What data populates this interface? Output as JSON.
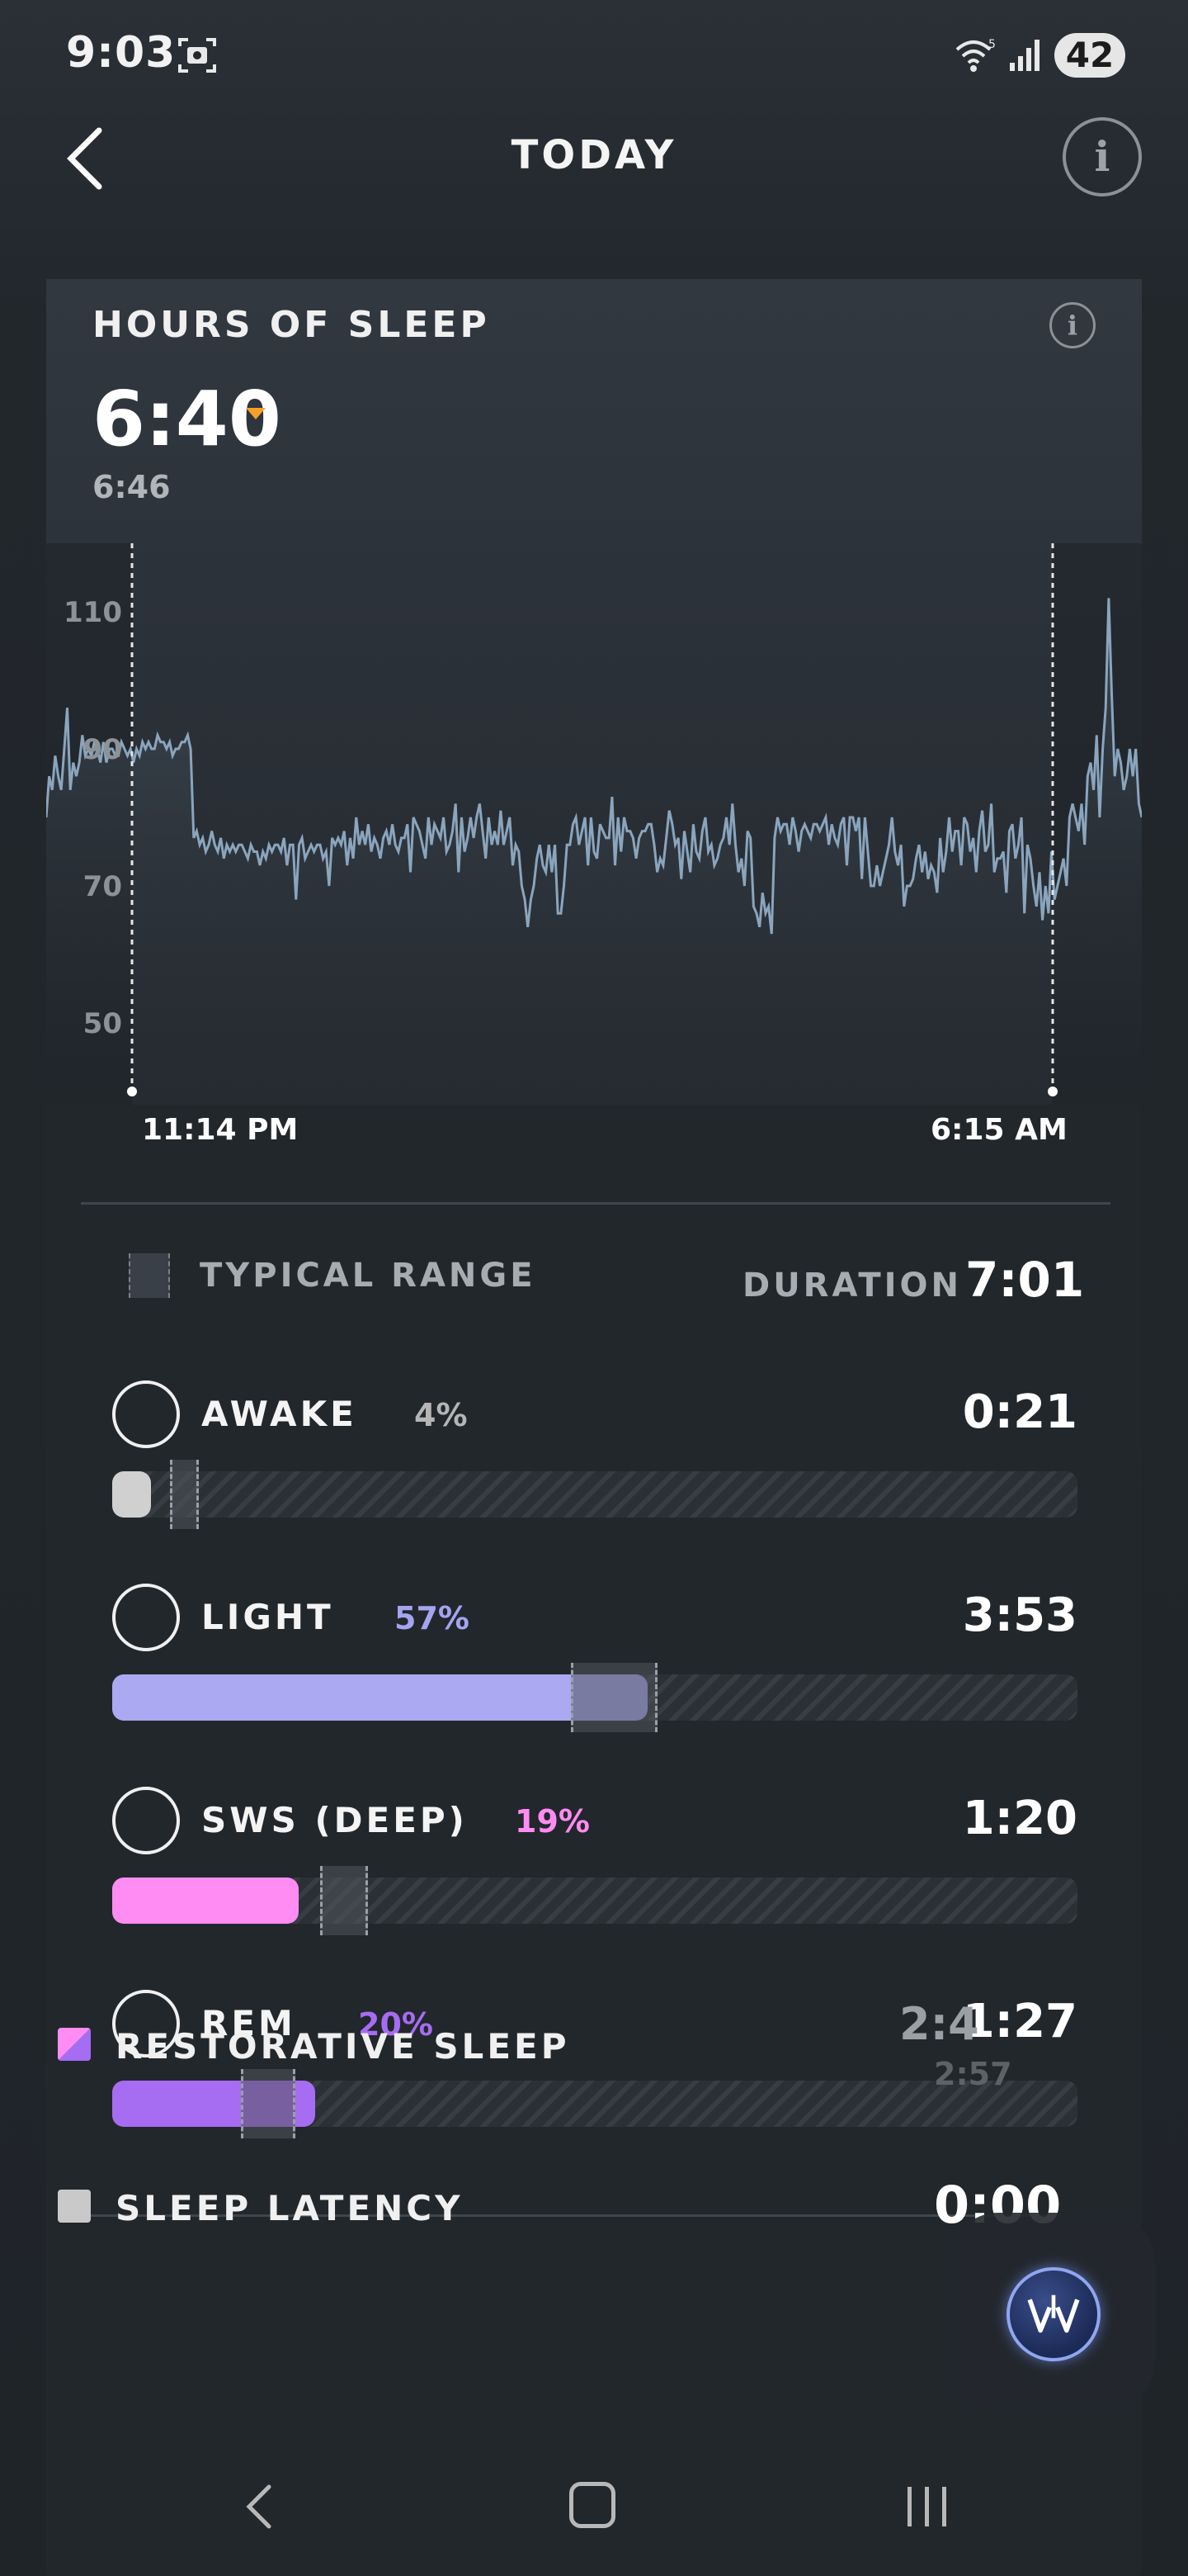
{
  "status_bar": {
    "time": "9:03",
    "battery": "42",
    "icons": [
      "screenshot-icon",
      "wifi-icon",
      "signal-icon"
    ]
  },
  "header": {
    "title": "TODAY",
    "back_icon": "chevron-left-icon",
    "info_icon": "info-icon",
    "info_glyph": "i"
  },
  "card": {
    "title": "HOURS OF SLEEP",
    "info_glyph": "i",
    "hours_of_sleep": "6:40",
    "sleep_needed": "6:46",
    "trend": "down",
    "accent_trend_color": "#f4a12a"
  },
  "chart_data": {
    "type": "line",
    "y_ticks": [
      "110",
      "90",
      "70",
      "50"
    ],
    "ylim": [
      40,
      120
    ],
    "start_marker": "11:14 PM",
    "end_marker": "6:15 AM",
    "series": [
      {
        "values": [
          80,
          86,
          84,
          89,
          86,
          84,
          90,
          96,
          84,
          88,
          86,
          88,
          92,
          89,
          90,
          89,
          91,
          90,
          88,
          91,
          88,
          90,
          90,
          89,
          89,
          91,
          90,
          89,
          90,
          88,
          90,
          89,
          91,
          90,
          91,
          90,
          90,
          92,
          91,
          91,
          90,
          91,
          89,
          90,
          90,
          91,
          91,
          92,
          90,
          77,
          78,
          76,
          77,
          75,
          76,
          78,
          76,
          75,
          77,
          74,
          76,
          75,
          76,
          75,
          76,
          76,
          75,
          74,
          76,
          75,
          75,
          73,
          75,
          74,
          76,
          75,
          76,
          76,
          75,
          77,
          73,
          76,
          76,
          68,
          76,
          77,
          74,
          75,
          76,
          75,
          76,
          76,
          74,
          75,
          70,
          77,
          76,
          77,
          76,
          78,
          73,
          77,
          74,
          80,
          76,
          78,
          76,
          79,
          75,
          77,
          76,
          74,
          77,
          78,
          76,
          79,
          76,
          75,
          77,
          77,
          79,
          72,
          80,
          79,
          78,
          76,
          74,
          80,
          76,
          79,
          78,
          77,
          80,
          75,
          76,
          78,
          82,
          72,
          80,
          75,
          77,
          80,
          77,
          80,
          82,
          78,
          74,
          80,
          76,
          78,
          76,
          81,
          76,
          78,
          80,
          73,
          76,
          75,
          70,
          68,
          64,
          68,
          70,
          74,
          76,
          73,
          72,
          76,
          72,
          76,
          66,
          66,
          70,
          76,
          76,
          79,
          80,
          76,
          78,
          80,
          73,
          80,
          75,
          74,
          79,
          78,
          77,
          77,
          83,
          73,
          80,
          75,
          80,
          78,
          78,
          77,
          74,
          77,
          78,
          78,
          79,
          79,
          76,
          72,
          74,
          73,
          77,
          81,
          79,
          76,
          77,
          71,
          78,
          75,
          72,
          79,
          75,
          74,
          78,
          80,
          75,
          76,
          73,
          74,
          76,
          77,
          80,
          76,
          82,
          76,
          72,
          74,
          70,
          78,
          77,
          67,
          66,
          64,
          69,
          66,
          67,
          63,
          77,
          80,
          78,
          79,
          79,
          76,
          80,
          78,
          75,
          78,
          79,
          78,
          77,
          79,
          79,
          78,
          79,
          80,
          76,
          79,
          77,
          76,
          79,
          80,
          73,
          80,
          80,
          78,
          80,
          71,
          80,
          75,
          70,
          70,
          73,
          70,
          72,
          74,
          76,
          80,
          75,
          73,
          76,
          67,
          70,
          70,
          71,
          74,
          76,
          72,
          75,
          71,
          73,
          72,
          69,
          77,
          72,
          75,
          80,
          75,
          78,
          78,
          73,
          80,
          79,
          75,
          77,
          72,
          78,
          81,
          75,
          76,
          82,
          72,
          74,
          74,
          75,
          69,
          78,
          79,
          74,
          76,
          80,
          66,
          76,
          74,
          70,
          67,
          72,
          65,
          70,
          66,
          75,
          68,
          70,
          72,
          74,
          70,
          80,
          82,
          80,
          78,
          82,
          76,
          86,
          88,
          84,
          92,
          80,
          90,
          96,
          112,
          98,
          86,
          90,
          88,
          84,
          86,
          90,
          86,
          90,
          82,
          80
        ]
      }
    ]
  },
  "legend": {
    "typical_range": "TYPICAL RANGE",
    "duration_label": "DURATION",
    "duration_value": "7:01"
  },
  "stages": [
    {
      "name": "AWAKE",
      "pct": "4%",
      "time": "0:21",
      "fraction": 0.04,
      "color": "#d0d0d0",
      "pct_color": "#b5b5b5",
      "typical_range": [
        0.06,
        0.09
      ]
    },
    {
      "name": "LIGHT",
      "pct": "57%",
      "time": "3:53",
      "fraction": 0.555,
      "color": "#aaa9f2",
      "pct_color": "#a5a4f0",
      "typical_range": [
        0.475,
        0.565
      ]
    },
    {
      "name": "SWS (DEEP)",
      "pct": "19%",
      "time": "1:20",
      "fraction": 0.193,
      "color": "#ff8cf2",
      "pct_color": "#ff8cf2",
      "typical_range": [
        0.215,
        0.265
      ]
    },
    {
      "name": "REM",
      "pct": "20%",
      "time": "1:27",
      "fraction": 0.21,
      "color": "#a66cf1",
      "pct_color": "#a66cf1",
      "typical_range": [
        0.133,
        0.19
      ]
    }
  ],
  "summary": {
    "restorative_label": "RESTORATIVE SLEEP",
    "restorative_value": "2:4",
    "restorative_sub": "2:57",
    "latency_label": "SLEEP LATENCY",
    "latency_value": "0:00"
  },
  "colors": {
    "background": "#22272c",
    "chart_line": "#8aa5bd",
    "accent_fab": "#8fa6f0"
  }
}
